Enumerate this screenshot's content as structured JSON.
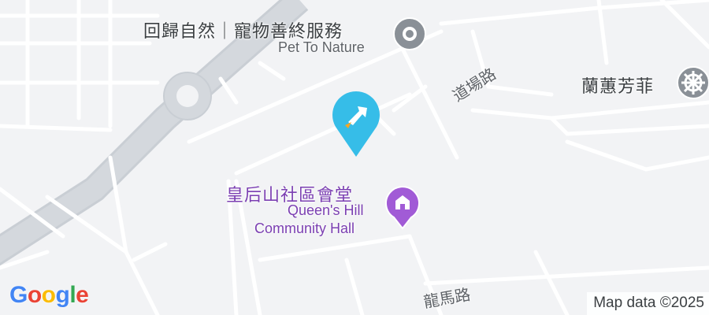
{
  "map": {
    "pois": {
      "pet_to_nature": {
        "name_zh": "回歸自然｜寵物善終服務",
        "name_en": "Pet To Nature",
        "icon": "pin-icon"
      },
      "lan_hui_fong_fei": {
        "name_zh": "蘭蕙芳菲",
        "icon": "dharma-wheel-icon"
      },
      "queens_hill_hall": {
        "name_zh": "皇后山社區會堂",
        "name_en_line1": "Queen's Hill",
        "name_en_line2": "Community Hall",
        "icon": "community-hall-icon"
      }
    },
    "roads": {
      "road_1": "道場路",
      "road_2": "龍馬路"
    },
    "marker": {
      "icon": "directions-marker-icon",
      "color": "#36bde8"
    },
    "attribution": "Map data ©2025",
    "logo": {
      "letters": [
        "G",
        "o",
        "o",
        "g",
        "l",
        "e"
      ],
      "colors": [
        "#4285f4",
        "#ea4335",
        "#fbbc05",
        "#4285f4",
        "#34a853",
        "#ea4335"
      ]
    }
  }
}
